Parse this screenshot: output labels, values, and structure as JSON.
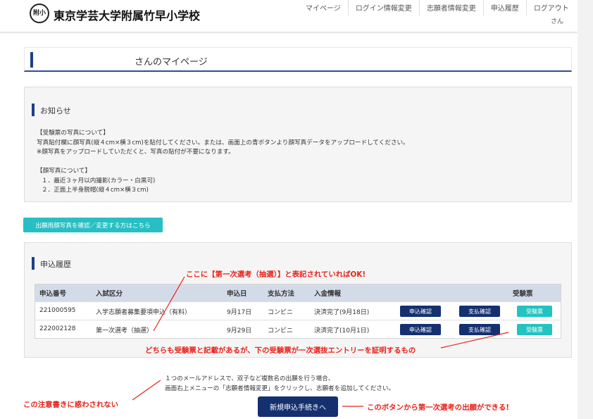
{
  "header": {
    "logo_text": "附小",
    "school_name": "東京学芸大学附属竹早小学校",
    "nav": [
      "マイページ",
      "ログイン情報変更",
      "志願者情報変更",
      "申込履歴",
      "ログアウト"
    ],
    "user_suffix": "さん"
  },
  "page": {
    "title": "さんのマイページ"
  },
  "notice": {
    "heading": "お知らせ",
    "lines": [
      "【受験票の写真について】",
      "写真貼付欄に顔写真(縦４cm×横３cm)を貼付してください。または、画面上の青ボタンより顔写真データをアップロードしてください。",
      "※顔写真をアップロードしていただくと、写真の貼付が不要になります。",
      "【顔写真について】",
      "１．最近３ヶ月以内撮影(カラー・白黒可)",
      "２．正面上半身脱帽(縦４cm×横３cm)"
    ]
  },
  "photo_button": "出願用顔写真を確認／変更する方はこちら",
  "history": {
    "heading": "申込履歴",
    "columns": [
      "申込番号",
      "入試区分",
      "申込日",
      "支払方法",
      "入金情報",
      "受験票"
    ],
    "rows": [
      {
        "number": "221000595",
        "category": "入学志願者募集要項申込（有料）",
        "date": "9月17日",
        "payment": "コンビニ",
        "status": "決済完了(9月18日)",
        "btn_apply": "申込確認",
        "btn_pay": "支払確認",
        "btn_ticket": "受験票"
      },
      {
        "number": "222002128",
        "category": "第一次選考（抽選）",
        "date": "9月29日",
        "payment": "コンビニ",
        "status": "決済完了(10月1日)",
        "btn_apply": "申込確認",
        "btn_pay": "支払確認",
        "btn_ticket": "受験票"
      }
    ]
  },
  "footer": {
    "note_line1": "１つのメールアドレスで、双子など複数名の出願を行う場合、",
    "note_line2": "画面右上メニューの「志願者情報変更」をクリックし、志願者を追加してください。",
    "new_button": "新規申込手続きへ"
  },
  "annotations": {
    "a1": "ここに【第一次選考（抽選）】と表記されていればOK!",
    "a2": "どちらも受験票と記載があるが、下の受験票が一次選抜エントリーを証明するもの",
    "a3": "この注意書きに惑わされない",
    "a4": "このボタンから第一次選考の出願ができる!"
  },
  "colors": {
    "navy": "#14306f",
    "teal": "#22c3c0",
    "annotation_red": "#e8231b"
  }
}
